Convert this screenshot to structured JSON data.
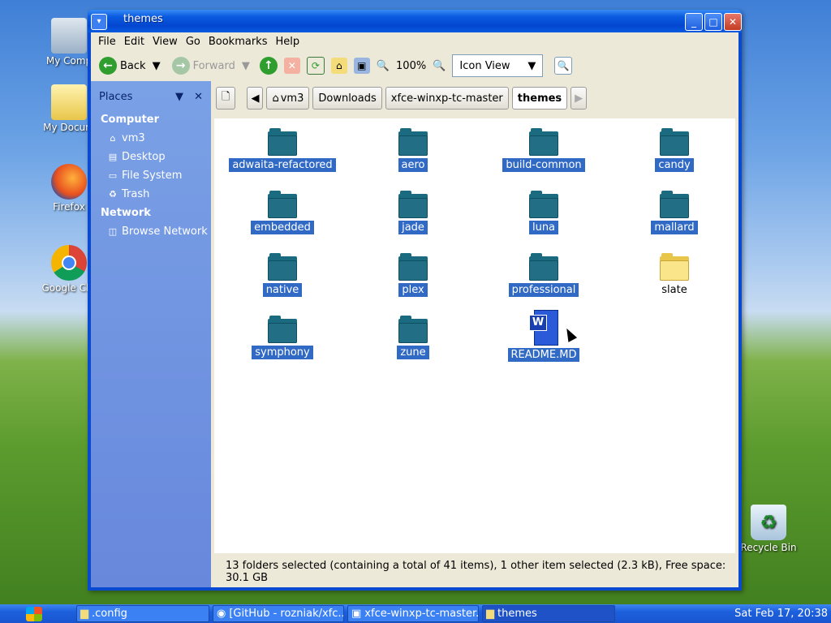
{
  "desktop": {
    "icons": [
      {
        "label": "My Comp"
      },
      {
        "label": "My Docum"
      },
      {
        "label": "Firefox"
      },
      {
        "label": "Google Chr"
      },
      {
        "label": "Recycle Bin"
      }
    ]
  },
  "window": {
    "title": "themes",
    "menu": [
      "File",
      "Edit",
      "View",
      "Go",
      "Bookmarks",
      "Help"
    ],
    "toolbar": {
      "back_label": "Back",
      "forward_label": "Forward",
      "zoom": "100%",
      "view_mode": "Icon View"
    },
    "sidebar": {
      "header": "Places",
      "computer_label": "Computer",
      "computer_items": [
        "vm3",
        "Desktop",
        "File System",
        "Trash"
      ],
      "network_label": "Network",
      "network_items": [
        "Browse Network"
      ]
    },
    "pathbar": [
      "vm3",
      "Downloads",
      "xfce-winxp-tc-master",
      "themes"
    ],
    "files": [
      {
        "name": "adwaita-refactored",
        "kind": "folder",
        "selected": true
      },
      {
        "name": "aero",
        "kind": "folder",
        "selected": true
      },
      {
        "name": "build-common",
        "kind": "folder",
        "selected": true
      },
      {
        "name": "candy",
        "kind": "folder",
        "selected": true
      },
      {
        "name": "embedded",
        "kind": "folder",
        "selected": true
      },
      {
        "name": "jade",
        "kind": "folder",
        "selected": true
      },
      {
        "name": "luna",
        "kind": "folder",
        "selected": true
      },
      {
        "name": "mallard",
        "kind": "folder",
        "selected": true
      },
      {
        "name": "native",
        "kind": "folder",
        "selected": true
      },
      {
        "name": "plex",
        "kind": "folder",
        "selected": true
      },
      {
        "name": "professional",
        "kind": "folder",
        "selected": true
      },
      {
        "name": "slate",
        "kind": "folder",
        "selected": false
      },
      {
        "name": "symphony",
        "kind": "folder",
        "selected": true
      },
      {
        "name": "zune",
        "kind": "folder",
        "selected": true
      },
      {
        "name": "README.MD",
        "kind": "document",
        "selected": true
      }
    ],
    "status": "13 folders selected (containing a total of 41 items), 1 other item selected (2.3 kB), Free space: 30.1 GB"
  },
  "taskbar": {
    "tasks": [
      ".config",
      "[GitHub - rozniak/xfc...",
      "xfce-winxp-tc-master...",
      "themes"
    ],
    "clock": "Sat Feb 17, 20:38"
  }
}
